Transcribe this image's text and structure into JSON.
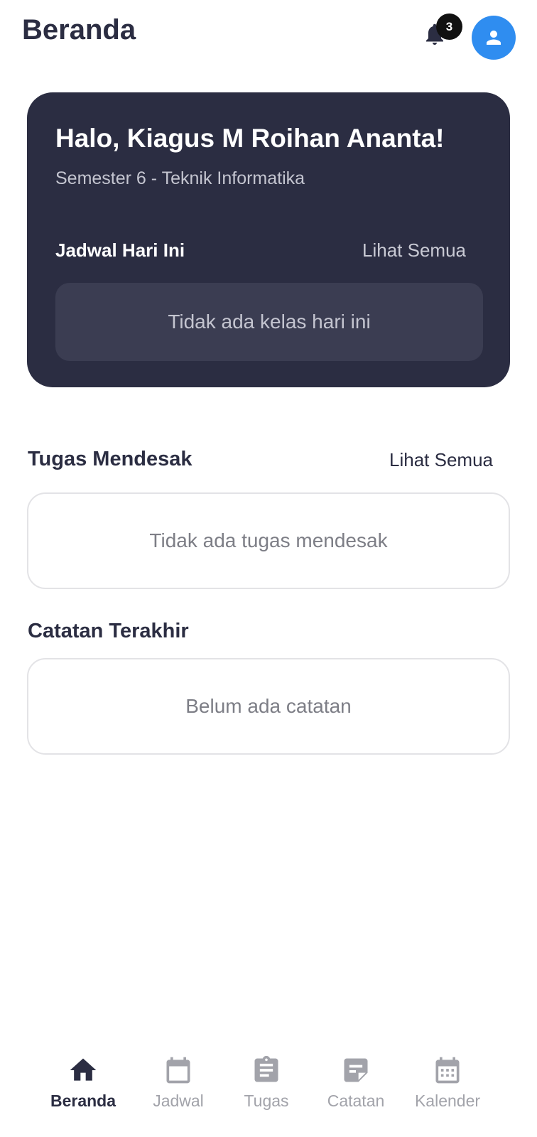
{
  "header": {
    "title": "Beranda",
    "notification_count": "3"
  },
  "hero": {
    "greeting": "Halo, Kiagus M Roihan Ananta!",
    "subtitle": "Semester 6 - Teknik Informatika",
    "schedule_title": "Jadwal Hari Ini",
    "schedule_link": "Lihat Semua",
    "schedule_empty": "Tidak ada kelas hari ini"
  },
  "tasks": {
    "title": "Tugas Mendesak",
    "link": "Lihat Semua",
    "empty": "Tidak ada tugas mendesak"
  },
  "notes": {
    "title": "Catatan Terakhir",
    "empty": "Belum ada catatan"
  },
  "nav": {
    "items": [
      {
        "label": "Beranda",
        "icon": "home-icon",
        "active": true
      },
      {
        "label": "Jadwal",
        "icon": "calendar-blank-icon",
        "active": false
      },
      {
        "label": "Tugas",
        "icon": "clipboard-icon",
        "active": false
      },
      {
        "label": "Catatan",
        "icon": "note-icon",
        "active": false
      },
      {
        "label": "Kalender",
        "icon": "calendar-grid-icon",
        "active": false
      }
    ]
  },
  "colors": {
    "primary_dark": "#2b2d42",
    "accent_blue": "#2f8df0",
    "inactive": "#a2a3aa"
  }
}
